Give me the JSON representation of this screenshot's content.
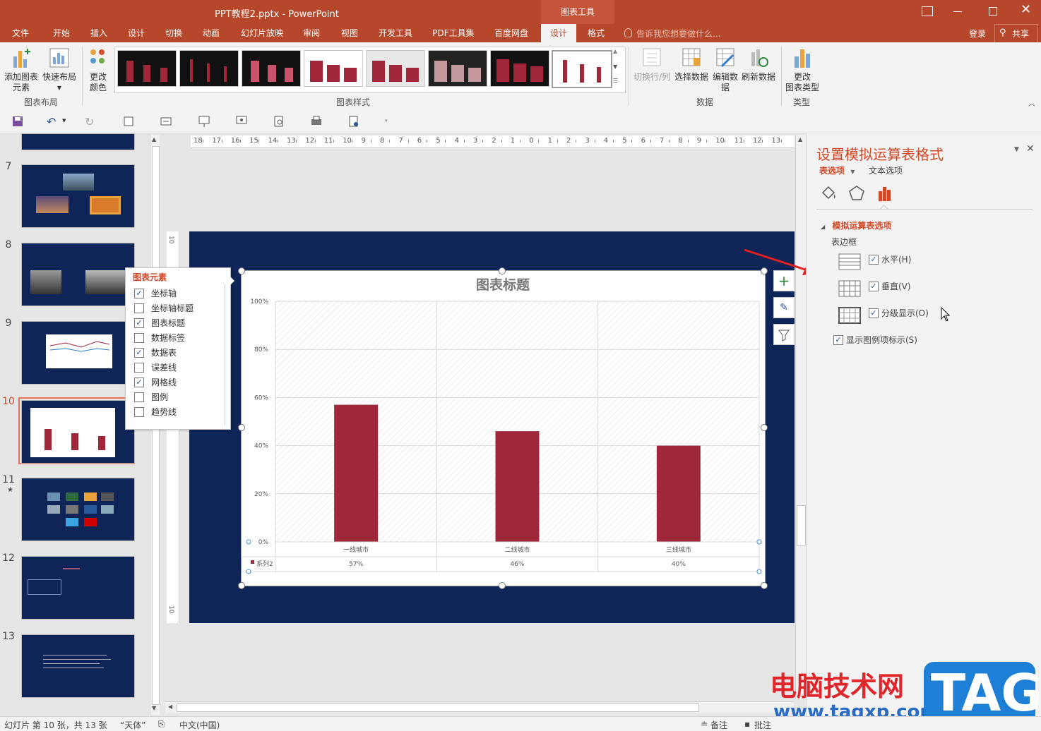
{
  "window": {
    "title": "PPT教程2.pptx - PowerPoint",
    "context_tab_group": "图表工具",
    "colors": {
      "accent": "#b7472a",
      "slide_bg": "#0f2457",
      "bar": "#a0263a"
    }
  },
  "tabs": [
    {
      "label": "文件"
    },
    {
      "label": "开始"
    },
    {
      "label": "插入"
    },
    {
      "label": "设计"
    },
    {
      "label": "切换"
    },
    {
      "label": "动画"
    },
    {
      "label": "幻灯片放映"
    },
    {
      "label": "审阅"
    },
    {
      "label": "视图"
    },
    {
      "label": "开发工具"
    },
    {
      "label": "PDF工具集"
    },
    {
      "label": "百度网盘"
    },
    {
      "label": "设计"
    },
    {
      "label": "格式"
    }
  ],
  "tell_me": "告诉我您想要做什么...",
  "login": "登录",
  "share": "共享",
  "ribbon": {
    "add_element_line1": "添加图表",
    "add_element_line2": "元素",
    "quick_layout": "快速布局",
    "change_color_line1": "更改",
    "change_color_line2": "颜色",
    "group_layout": "图表布局",
    "group_styles": "图表样式",
    "switch_rowcol": "切换行/列",
    "select_data": "选择数据",
    "edit_data_line1": "编辑数",
    "edit_data_line2": "据",
    "refresh_data": "刷新数据",
    "group_data": "数据",
    "change_type_line1": "更改",
    "change_type_line2": "图表类型",
    "group_type": "类型"
  },
  "slides": [
    {
      "num": "7"
    },
    {
      "num": "8"
    },
    {
      "num": "9"
    },
    {
      "num": "10"
    },
    {
      "num": "11"
    },
    {
      "num": "12"
    },
    {
      "num": "13"
    }
  ],
  "ruler": {
    "horizontal": [
      "18",
      "17",
      "16",
      "15",
      "14",
      "13",
      "12",
      "11",
      "10",
      "9",
      "8",
      "7",
      "6",
      "5",
      "4",
      "3",
      "2",
      "1",
      "0",
      "1",
      "2",
      "3",
      "4",
      "5",
      "6",
      "7",
      "8",
      "9",
      "10",
      "11",
      "12",
      "13"
    ],
    "vertical_top": "10",
    "vertical_bottom": "10"
  },
  "chart_elements_popup": {
    "title": "图表元素",
    "items": [
      {
        "label": "坐标轴",
        "checked": true
      },
      {
        "label": "坐标轴标题",
        "checked": false
      },
      {
        "label": "图表标题",
        "checked": true
      },
      {
        "label": "数据标签",
        "checked": false
      },
      {
        "label": "数据表",
        "checked": true
      },
      {
        "label": "误差线",
        "checked": false
      },
      {
        "label": "网格线",
        "checked": true
      },
      {
        "label": "图例",
        "checked": false
      },
      {
        "label": "趋势线",
        "checked": false
      }
    ]
  },
  "chart_data": {
    "type": "bar",
    "title": "图表标题",
    "categories": [
      "一线城市",
      "二线城市",
      "三线城市"
    ],
    "series": [
      {
        "name": "系列2",
        "values": [
          0.57,
          0.46,
          0.4
        ]
      }
    ],
    "table_values": [
      "57%",
      "46%",
      "40%"
    ],
    "ytick_labels": [
      "0%",
      "20%",
      "40%",
      "60%",
      "80%",
      "100%"
    ],
    "ylim": [
      0,
      1
    ],
    "grid": true,
    "legend": "none",
    "data_table": true
  },
  "format_pane": {
    "title": "设置模拟运算表格式",
    "tab_table": "表选项",
    "tab_text": "文本选项",
    "section": "模拟运算表选项",
    "border_label": "表边框",
    "horizontal": "水平(H)",
    "vertical": "垂直(V)",
    "outline": "分级显示(O)",
    "show_legend_keys": "显示图例项标示(S)"
  },
  "status": {
    "slide_info": "幻灯片 第 10 张，共 13 张",
    "theme": "“天体”",
    "language": "中文(中国)",
    "notes": "备注",
    "comments": "批注"
  },
  "watermark": {
    "site_name": "电脑技术网",
    "url": "www.tagxp.com",
    "logo": "TAG"
  }
}
